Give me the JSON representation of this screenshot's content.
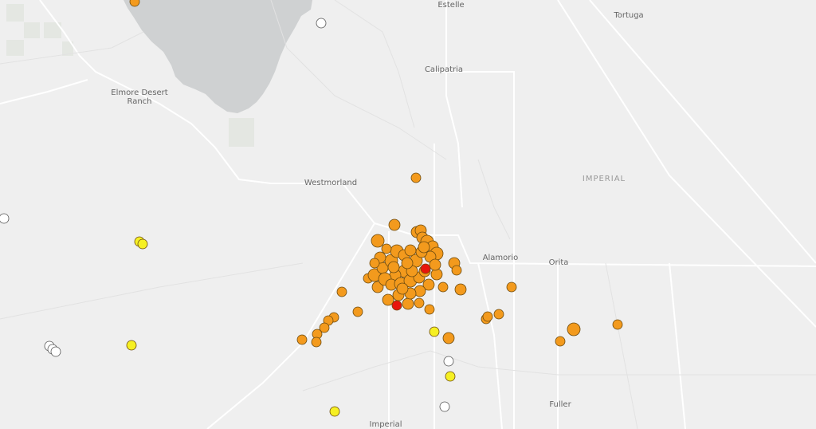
{
  "map": {
    "place_labels": [
      {
        "id": "estelle",
        "text": "Estelle"
      },
      {
        "id": "tortuga",
        "text": "Tortuga"
      },
      {
        "id": "calipatria",
        "text": "Calipatria"
      },
      {
        "id": "elmore-desert-ranch",
        "text": "Elmore Desert",
        "text2": "Ranch"
      },
      {
        "id": "westmorland",
        "text": "Westmorland"
      },
      {
        "id": "imperial-county",
        "text": "IMPERIAL"
      },
      {
        "id": "alamorio",
        "text": "Alamorio"
      },
      {
        "id": "orita",
        "text": "Orita"
      },
      {
        "id": "fuller",
        "text": "Fuller"
      },
      {
        "id": "imperial",
        "text": "Imperial"
      }
    ],
    "colors": {
      "land": "#efefef",
      "water": "#cfd1d2",
      "roads": "#ffffff",
      "agricultural": "#e4e7e2",
      "marker_orange": "#f39a1d",
      "marker_red": "#e8150c",
      "marker_yellow": "#f6f023",
      "marker_white": "#ffffff",
      "marker_stroke": "#6b4a10"
    },
    "earthquake_marker_counts": {
      "red": 2,
      "yellow": 6,
      "white": 7
    }
  }
}
